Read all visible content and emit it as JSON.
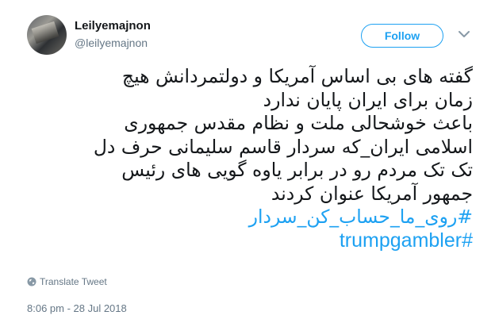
{
  "author": {
    "display_name": "Leilyemajnon",
    "handle": "@leilyemajnon",
    "avatar_icon": "profile-photo"
  },
  "follow_button": {
    "label": "Follow",
    "color": "#1da1f2"
  },
  "menu_icon": "chevron-down-icon",
  "tweet": {
    "lines": [
      "گفته های بی اساس آمریکا و دولتمردانش هیچ",
      "زمان برای ایران پایان ندارد",
      "باعث خوشحالی ملت و نظام مقدس جمهوری",
      "اسلامی ایران_که سردار قاسم سلیمانی حرف دل",
      "تک تک مردم رو در برابر یاوه گویی های رئیس",
      "جمهور آمریکا عنوان کردند"
    ],
    "hashtags": [
      "#روی_ما_حساب_کن_سردار",
      "#trumpgambler"
    ],
    "hashtag_color": "#1da1f2"
  },
  "translate_label": "Translate Tweet",
  "timestamp": "8:06 pm - 28 Jul 2018"
}
